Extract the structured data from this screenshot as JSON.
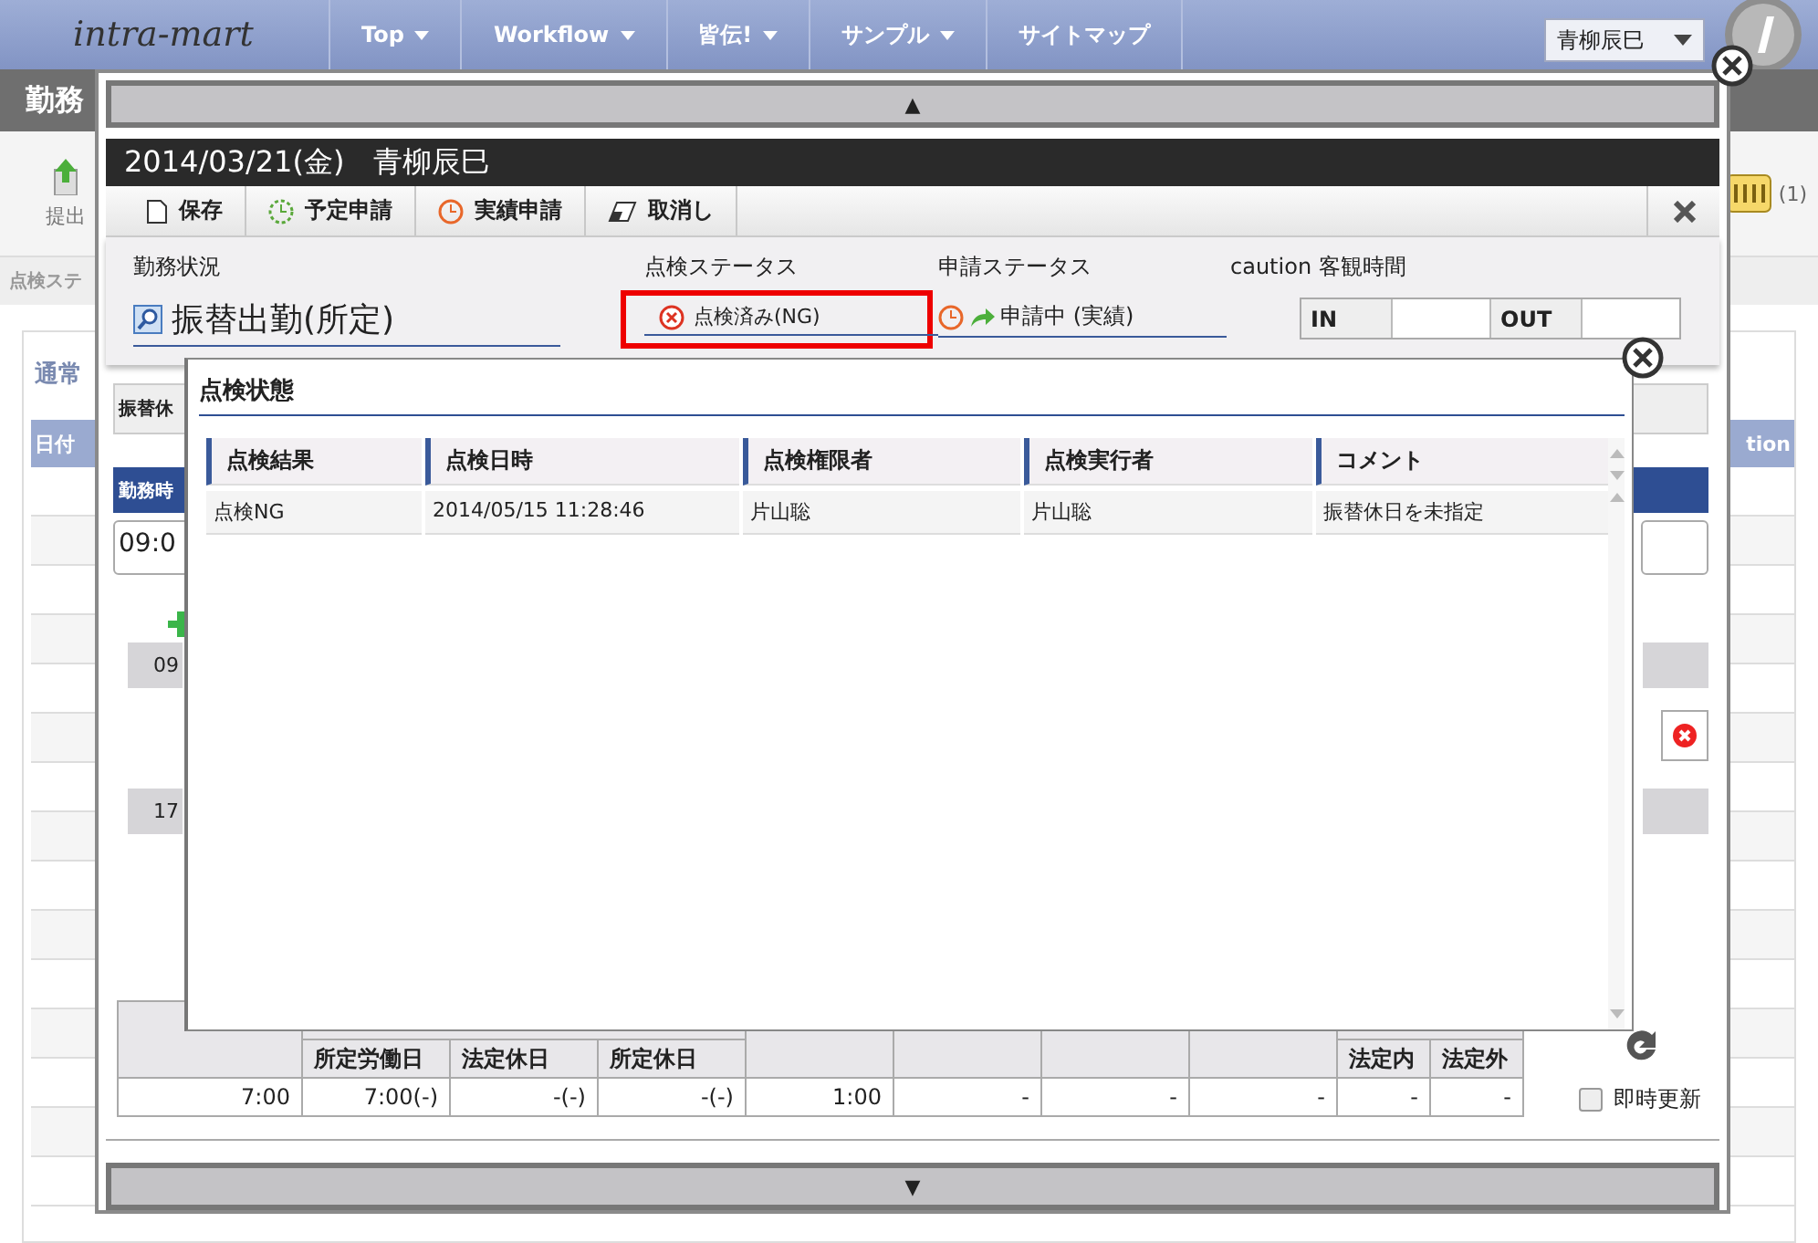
{
  "nav": {
    "logo": "intra-mart",
    "menus": [
      {
        "label": "Top",
        "dropdown": true
      },
      {
        "label": "Workflow",
        "dropdown": true
      },
      {
        "label": "皆伝!",
        "dropdown": true
      },
      {
        "label": "サンプル",
        "dropdown": true
      },
      {
        "label": "サイトマップ",
        "dropdown": false
      }
    ],
    "user": "青柳辰巳"
  },
  "page": {
    "title": "勤務",
    "submit_label": "提出",
    "badge": "(1)",
    "filter_label": "点検ステ",
    "section_tab": "通常",
    "column_1": "日付",
    "column_2": "tion"
  },
  "dialog": {
    "scroll_up": "▲",
    "scroll_down": "▼",
    "title": "2014/03/21(金)　青柳辰巳",
    "buttons": [
      {
        "kind": "save",
        "label": "保存"
      },
      {
        "kind": "plan",
        "label": "予定申請"
      },
      {
        "kind": "actual",
        "label": "実績申請"
      },
      {
        "kind": "cancel",
        "label": "取消し"
      }
    ],
    "fields": {
      "work_status_label": "勤務状況",
      "work_status": "振替出勤(所定)",
      "check_status_label": "点検ステータス",
      "check_status": "点検済み(NG)",
      "apply_status_label": "申請ステータス",
      "apply_status": "申請中 (実績)",
      "time_label": "caution 客観時間",
      "in_label": "IN",
      "out_label": "OUT"
    },
    "section_label": "振替休",
    "time_header": "勤務時",
    "time_input": "09:0",
    "slots": [
      "09",
      "17"
    ],
    "summary": {
      "sub_headers": [
        "所定労働日",
        "法定休日",
        "所定休日",
        "法定内",
        "法定外"
      ],
      "values": [
        "7:00",
        "7:00(-)",
        "-(-)",
        "-(-)",
        "1:00",
        "-",
        "-",
        "-",
        "-",
        "-"
      ]
    },
    "realtime_label": "即時更新",
    "realtime_checked": false
  },
  "popup": {
    "title": "点検状態",
    "columns": [
      "点検結果",
      "点検日時",
      "点検権限者",
      "点検実行者",
      "コメント"
    ],
    "rows": [
      [
        "点検NG",
        "2014/05/15 11:28:46",
        "片山聡",
        "片山聡",
        "振替休日を未指定"
      ]
    ]
  }
}
